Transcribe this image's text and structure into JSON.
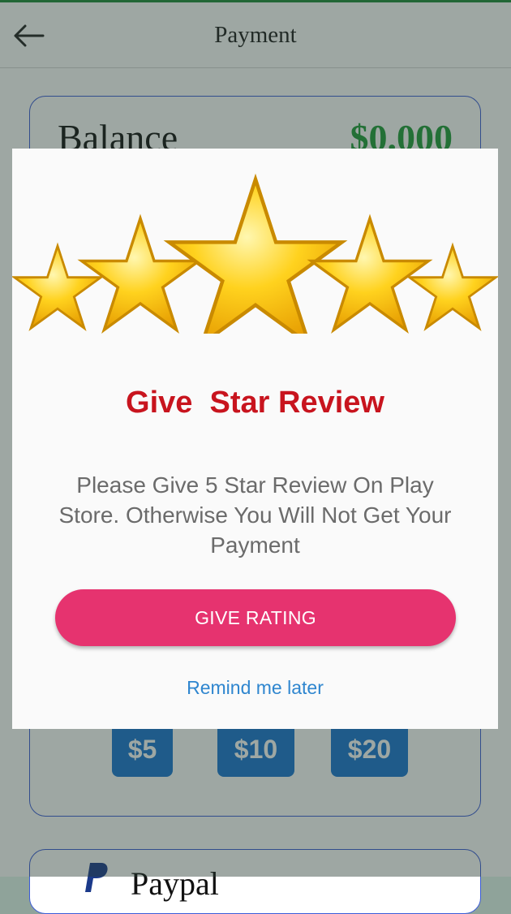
{
  "appbar": {
    "title": "Payment",
    "back_icon": "arrow-left-icon"
  },
  "balance": {
    "label": "Balance",
    "value": "$0.000"
  },
  "amount_options": [
    "$5",
    "$10",
    "$20"
  ],
  "payment_method": {
    "label": "Paypal",
    "icon": "paypal-icon"
  },
  "dialog": {
    "title": "Give  Star Review",
    "message": "Please Give 5 Star Review On Play Store. Otherwise You Will Not Get Your Payment",
    "primary_button": "GIVE RATING",
    "secondary_link": "Remind me later",
    "stars_icon": "five-stars-icon",
    "star_count": 5
  },
  "colors": {
    "status_accent": "#1e8a3a",
    "balance_value": "#1f9c3a",
    "card_border": "#3b5bd8",
    "amount_button": "#1976d2",
    "dialog_title": "#c8141e",
    "rate_button": "#e6336f",
    "link": "#2f86cf"
  }
}
